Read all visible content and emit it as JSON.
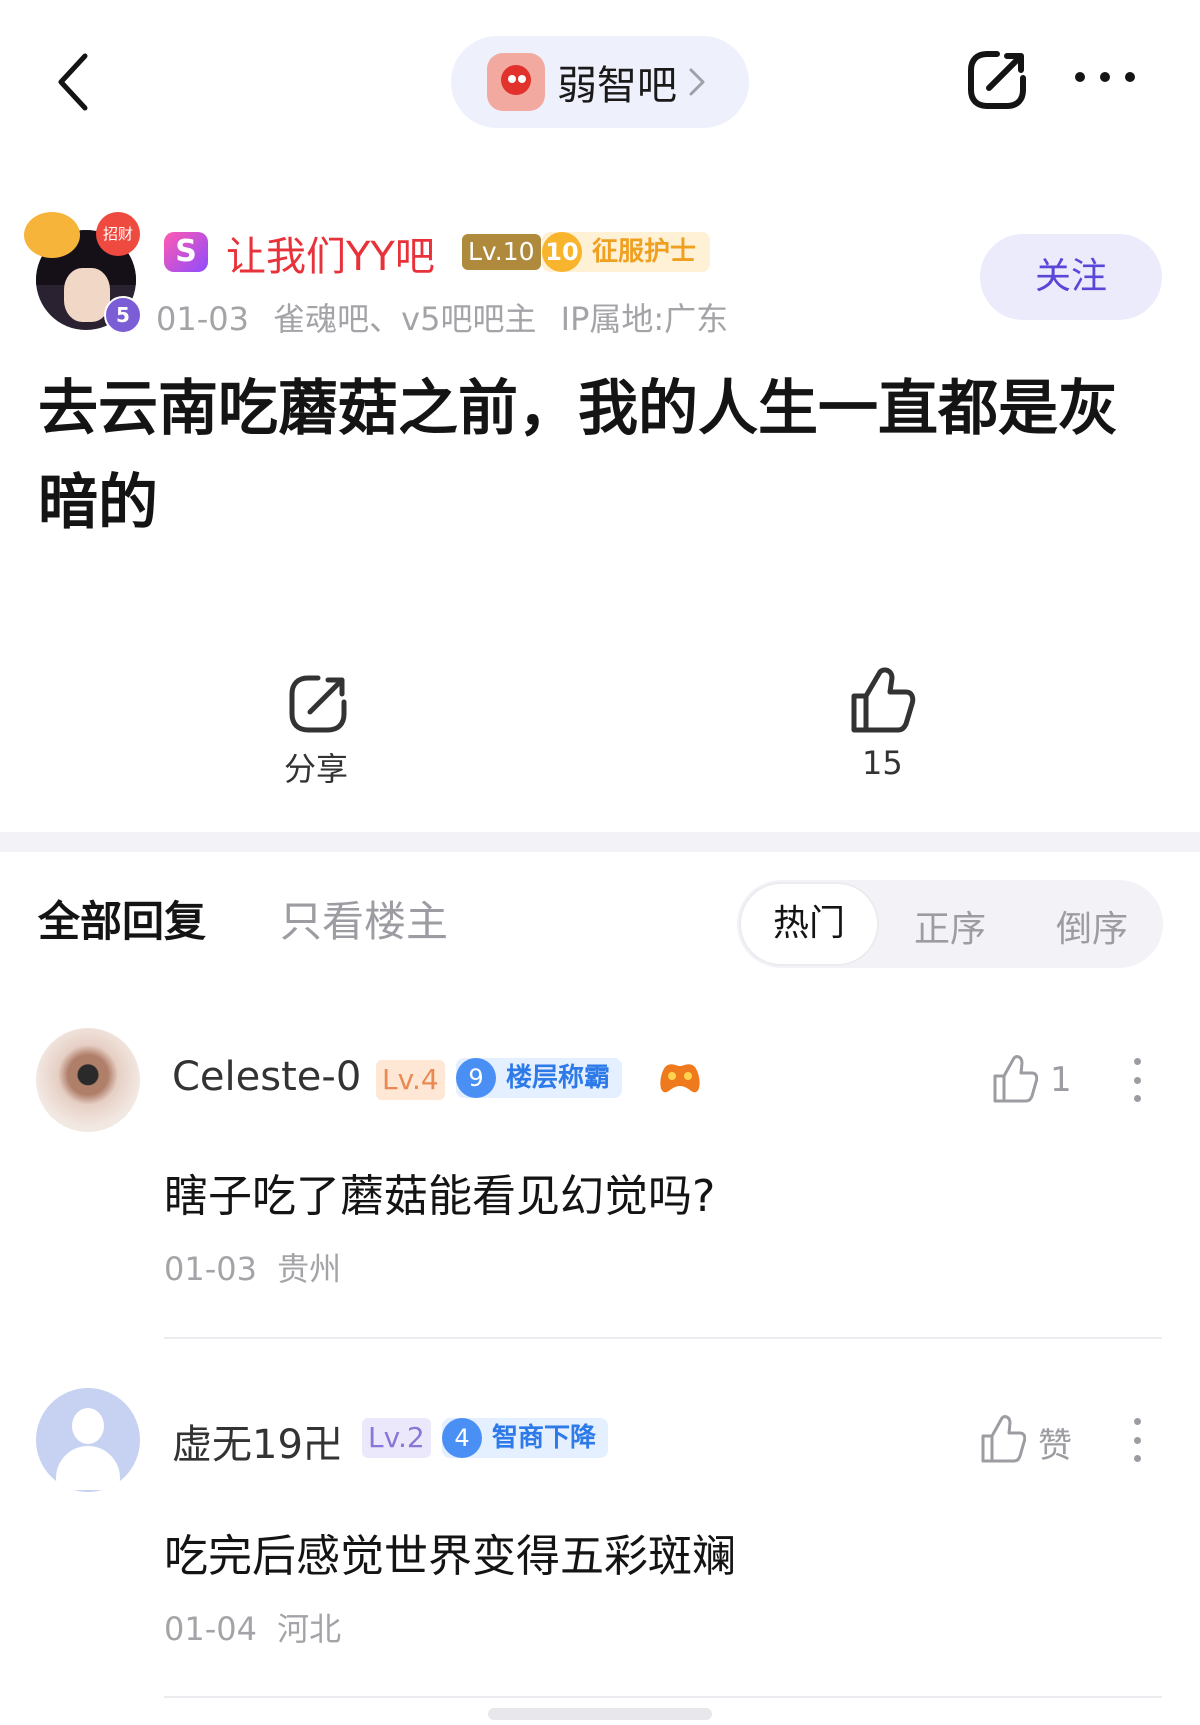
{
  "header": {
    "forum_name": "弱智吧"
  },
  "post": {
    "author": {
      "name": "让我们YY吧",
      "level": "Lv.10",
      "title_level": "10",
      "title": "征服护士",
      "avatar_badge": "招财",
      "avatar_level": "5"
    },
    "meta": "01-03  雀魂吧、v5吧吧主  IP属地:广东",
    "follow_label": "关注",
    "title": "去云南吃蘑菇之前，我的人生一直都是灰暗的",
    "share_label": "分享",
    "like_count": "15"
  },
  "replies_header": {
    "tab_all": "全部回复",
    "tab_op_only": "只看楼主",
    "sort_hot": "热门",
    "sort_asc": "正序",
    "sort_desc": "倒序"
  },
  "replies": [
    {
      "user": "Celeste-0",
      "level": "Lv.4",
      "title_level": "9",
      "title": "楼层称霸",
      "content": "瞎子吃了蘑菇能看见幻觉吗?",
      "meta": "01-03 贵州",
      "like": "1"
    },
    {
      "user": "虚无19卍",
      "level": "Lv.2",
      "title_level": "4",
      "title": "智商下降",
      "content": "吃完后感觉世界变得五彩斑斓",
      "meta": "01-04 河北",
      "like": "赞"
    }
  ],
  "colors": {
    "accent": "#5a47d8",
    "author_name": "#e8323a",
    "title_badge": "#f0a020",
    "blue_badge": "#2d7ae8"
  },
  "icons": [
    "back-icon",
    "share-icon",
    "more-icon",
    "like-icon",
    "gamepad-icon",
    "kebab-icon"
  ]
}
